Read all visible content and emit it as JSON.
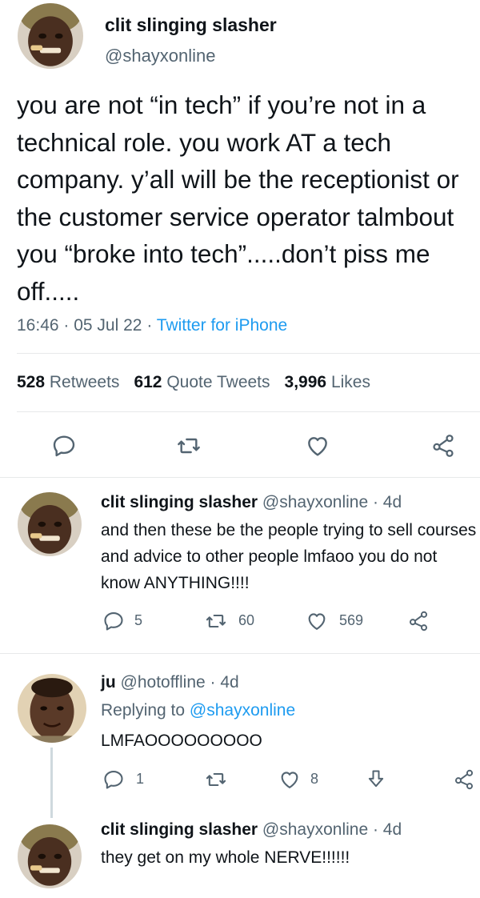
{
  "main_tweet": {
    "display_name": "clit slinging slasher",
    "handle": "@shayxonline",
    "text": "you are not “in tech” if you’re not in a technical role. you work AT a tech company. y’all will be the receptionist or the customer service operator talmbout you “broke into tech”.....don’t piss me off.....",
    "time": "16:46",
    "date": "05 Jul 22",
    "source": "Twitter for iPhone",
    "retweets_count": "528",
    "retweets_label": "Retweets",
    "quotes_count": "612",
    "quotes_label": "Quote Tweets",
    "likes_count": "3,996",
    "likes_label": "Likes"
  },
  "replies": [
    {
      "display_name": "clit slinging slasher",
      "handle_time": "@shayxonline · 4d",
      "text": "and then these be the people trying to sell courses and advice to other people lmfaoo you do not know ANYTHING!!!!",
      "reply_count": "5",
      "retweet_count": "60",
      "like_count": "569"
    },
    {
      "display_name": "ju",
      "handle_time": "@hotoffline · 4d",
      "replying_prefix": "Replying to",
      "replying_to": "@shayxonline",
      "text": "LMFAOOOOOOOOO",
      "reply_count": "1",
      "like_count": "8"
    },
    {
      "display_name": "clit slinging slasher",
      "handle_time": "@shayxonline · 4d",
      "text": "they get on my whole NERVE!!!!!!"
    }
  ],
  "icons": {
    "reply": "reply-icon",
    "retweet": "retweet-icon",
    "like": "heart-icon",
    "share": "share-icon",
    "download": "download-icon"
  },
  "colors": {
    "text": "#0f1419",
    "secondary": "#536471",
    "link": "#1d9bf0",
    "divider": "#e7e9ea"
  }
}
